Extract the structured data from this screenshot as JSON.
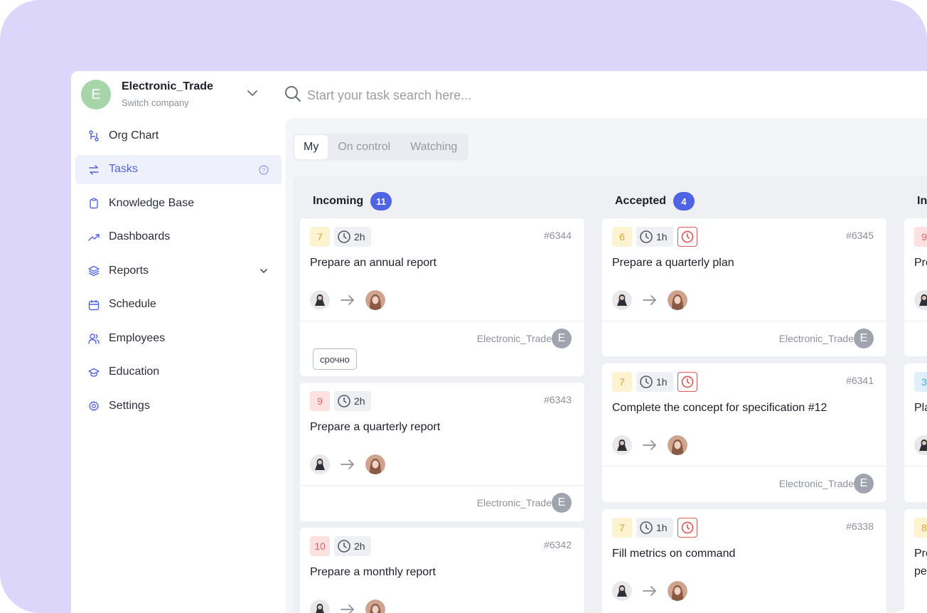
{
  "company": {
    "initial": "E",
    "name": "Electronic_Trade",
    "subtitle": "Switch company"
  },
  "search": {
    "placeholder": "Start your task search here..."
  },
  "sidebar": {
    "items": [
      {
        "label": "Org Chart",
        "icon": "org-chart-icon"
      },
      {
        "label": "Tasks",
        "icon": "tasks-icon",
        "active": true
      },
      {
        "label": "Knowledge Base",
        "icon": "clipboard-icon"
      },
      {
        "label": "Dashboards",
        "icon": "trend-icon"
      },
      {
        "label": "Reports",
        "icon": "layers-icon"
      },
      {
        "label": "Schedule",
        "icon": "calendar-icon"
      },
      {
        "label": "Employees",
        "icon": "users-icon"
      },
      {
        "label": "Education",
        "icon": "graduation-cap-icon"
      },
      {
        "label": "Settings",
        "icon": "gear-icon"
      }
    ]
  },
  "tabs": [
    "My",
    "On control",
    "Watching"
  ],
  "columns": [
    {
      "title": "Incoming",
      "count": "11",
      "cards": [
        {
          "priority": "7",
          "priority_color": "yellow",
          "time": "2h",
          "id": "#6344",
          "title": "Prepare an annual report",
          "company": "Electronic_Trade",
          "company_initial": "E",
          "tag": "срочно"
        },
        {
          "priority": "9",
          "priority_color": "red",
          "time": "2h",
          "id": "#6343",
          "title": "Prepare a quarterly report",
          "company": "Electronic_Trade",
          "company_initial": "E"
        },
        {
          "priority": "10",
          "priority_color": "red",
          "time": "2h",
          "id": "#6342",
          "title": "Prepare a monthly report"
        }
      ]
    },
    {
      "title": "Accepted",
      "count": "4",
      "cards": [
        {
          "priority": "6",
          "priority_color": "yellow",
          "time": "1h",
          "overdue": true,
          "id": "#6345",
          "title": "Prepare a quarterly plan",
          "company": "Electronic_Trade",
          "company_initial": "E"
        },
        {
          "priority": "7",
          "priority_color": "yellow",
          "time": "1h",
          "overdue": true,
          "id": "#6341",
          "title": "Complete the concept for specification #12",
          "company": "Electronic_Trade",
          "company_initial": "E"
        },
        {
          "priority": "7",
          "priority_color": "yellow",
          "time": "1h",
          "overdue": true,
          "id": "#6338",
          "title": "Fill metrics on command"
        }
      ]
    },
    {
      "title": "In",
      "cards": [
        {
          "priority": "9",
          "priority_color": "red",
          "title": "Pre"
        },
        {
          "priority": "3",
          "priority_color": "blue",
          "title": "Pla"
        },
        {
          "priority": "8",
          "priority_color": "yellow",
          "title": "Pre",
          "title_line2": "pe"
        }
      ]
    }
  ],
  "colors": {
    "accent": "#4f63e5",
    "frame_bg": "#dcd6fb",
    "overdue": "#e55a5a"
  }
}
